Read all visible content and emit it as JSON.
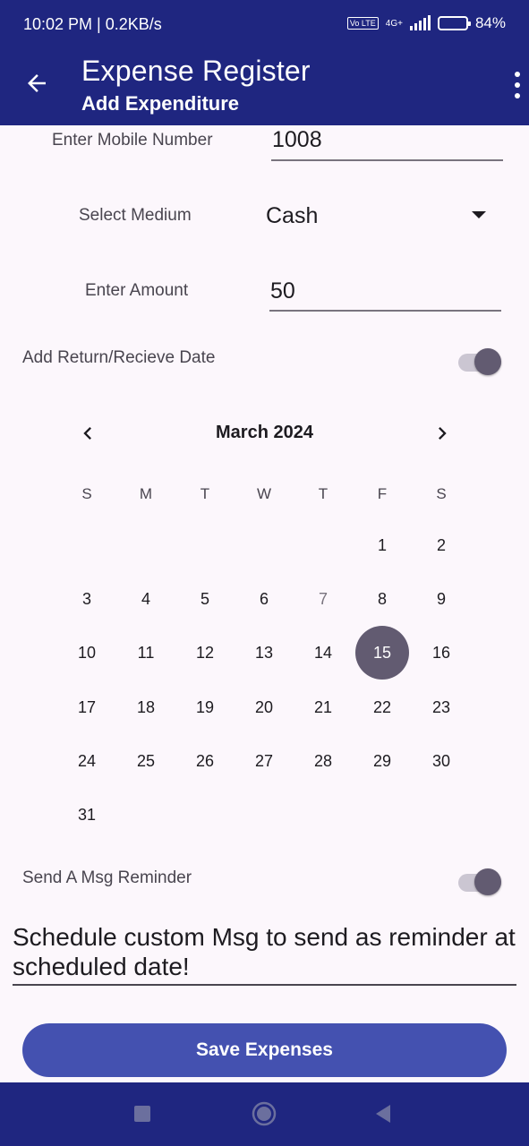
{
  "status_bar": {
    "time": "10:02 PM | 0.2KB/s",
    "volte": "Vo LTE",
    "network": "4G+",
    "battery_percent": "84%",
    "battery_level": 0.84
  },
  "app_bar": {
    "title": "Expense Register",
    "subtitle": "Add Expenditure",
    "back_icon": "arrow-left-icon",
    "menu_icon": "more-vertical-icon"
  },
  "form": {
    "mobile": {
      "label": "Enter Mobile Number",
      "value": "1008"
    },
    "medium": {
      "label": "Select Medium",
      "value": "Cash"
    },
    "amount": {
      "label": "Enter Amount",
      "value": "50"
    },
    "return_date": {
      "label": "Add Return/Recieve Date",
      "enabled": true
    },
    "reminder": {
      "label": "Send A Msg Reminder",
      "enabled": true
    },
    "custom_msg": "Schedule custom Msg to send as reminder at scheduled date!"
  },
  "calendar": {
    "month_title": "March 2024",
    "weekdays": [
      "S",
      "M",
      "T",
      "W",
      "T",
      "F",
      "S"
    ],
    "first_weekday_index": 5,
    "days_in_month": 31,
    "today": 7,
    "selected": 15
  },
  "actions": {
    "save_label": "Save Expenses"
  },
  "colors": {
    "primary_dark": "#1f2680",
    "button": "#4451b0",
    "selected_day": "#625b71",
    "background": "#fcf7fc"
  }
}
